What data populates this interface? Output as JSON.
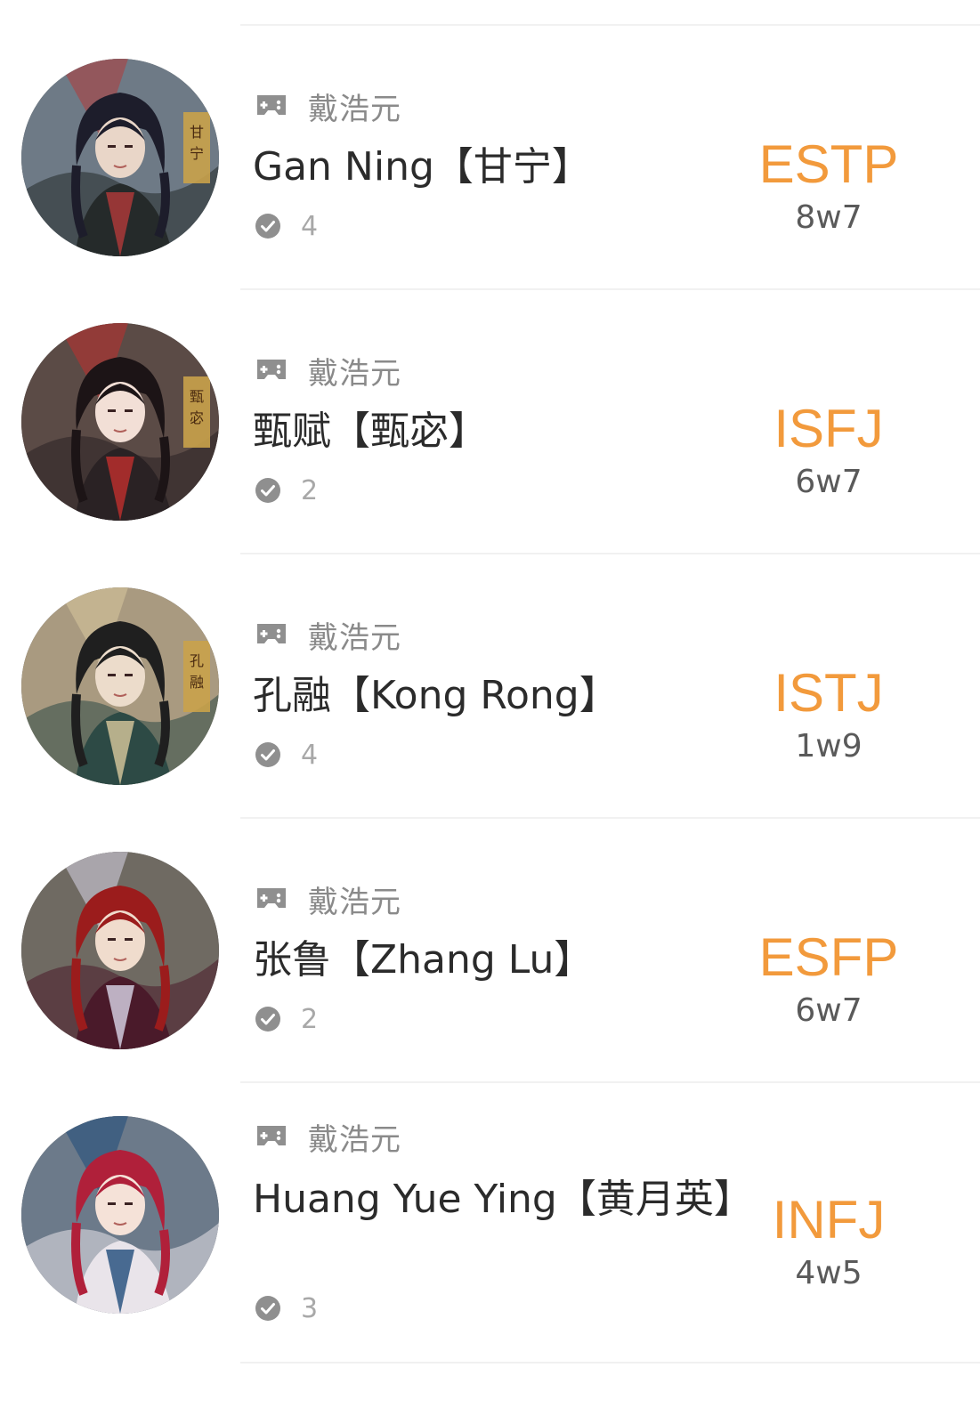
{
  "accent_color": "#f29a3c",
  "items": [
    {
      "creator": "戴浩元",
      "name": "Gan Ning【甘宁】",
      "votes": "4",
      "mbti": "ESTP",
      "enneagram": "8w7",
      "avatar": {
        "bg": "#6e7a86",
        "hair": "#1d1d2b",
        "robe": "#252a2a",
        "accent": "#b33a3a",
        "skin": "#e9d6c8",
        "label": "甘宁"
      }
    },
    {
      "creator": "戴浩元",
      "name": "甄赋【甄宓】",
      "votes": "2",
      "mbti": "ISFJ",
      "enneagram": "6w7",
      "avatar": {
        "bg": "#5b4b46",
        "hair": "#1c1416",
        "robe": "#2a2224",
        "accent": "#c0302d",
        "skin": "#f2dfd6",
        "label": "甄宓"
      }
    },
    {
      "creator": "戴浩元",
      "name": "孔融【Kong Rong】",
      "votes": "4",
      "mbti": "ISTJ",
      "enneagram": "1w9",
      "avatar": {
        "bg": "#a99a80",
        "hair": "#1f1f1f",
        "robe": "#2d4a45",
        "accent": "#d8c89c",
        "skin": "#ecdccb",
        "label": "孔融"
      }
    },
    {
      "creator": "戴浩元",
      "name": "张鲁【Zhang Lu】",
      "votes": "2",
      "mbti": "ESFP",
      "enneagram": "6w7",
      "avatar": {
        "bg": "#6f6a62",
        "hair": "#9b1c1c",
        "robe": "#4a1a2a",
        "accent": "#d9d6e8",
        "skin": "#f0dccd",
        "label": ""
      }
    },
    {
      "creator": "戴浩元",
      "name": "Huang Yue Ying【黄月英】",
      "votes": "3",
      "mbti": "INFJ",
      "enneagram": "4w5",
      "avatar": {
        "bg": "#6c7a8a",
        "hair": "#b0203a",
        "robe": "#e9e4ea",
        "accent": "#1f4b7a",
        "skin": "#f5e2d8",
        "label": ""
      }
    }
  ]
}
